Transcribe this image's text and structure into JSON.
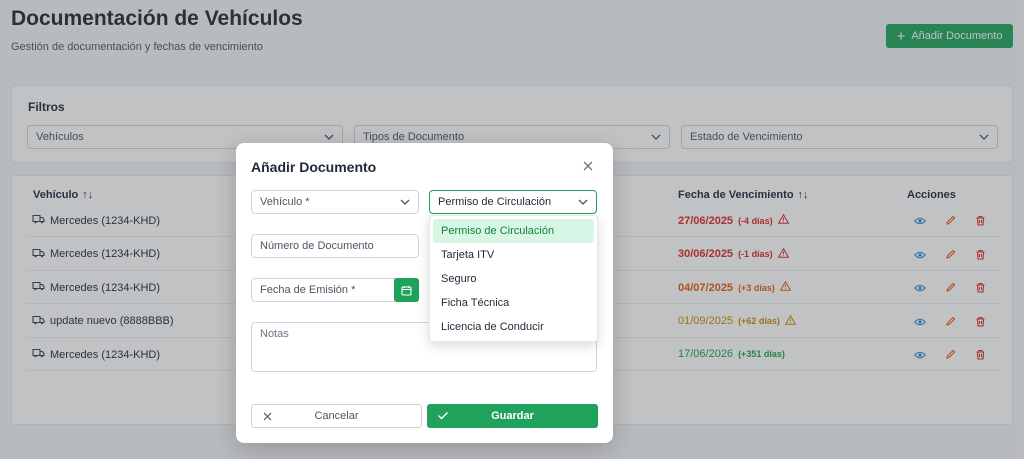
{
  "header": {
    "title": "Documentación de Vehículos",
    "subtitle": "Gestión de documentación y fechas de vencimiento",
    "add_button": "Añadir Documento"
  },
  "filters": {
    "title": "Filtros",
    "vehicles": "Vehículos",
    "doc_types": "Tipos de Documento",
    "expiry_state": "Estado de Vencimiento"
  },
  "table": {
    "col_vehicle": "Vehículo",
    "col_expiry": "Fecha de Vencimiento",
    "col_actions": "Acciones",
    "rows": [
      {
        "vehicle": "Mercedes (1234-KHD)",
        "date": "27/06/2025",
        "rel": "(-4 días)",
        "status": "red",
        "warn": true
      },
      {
        "vehicle": "Mercedes (1234-KHD)",
        "date": "30/06/2025",
        "rel": "(-1 días)",
        "status": "red",
        "warn": true
      },
      {
        "vehicle": "Mercedes (1234-KHD)",
        "date": "04/07/2025",
        "rel": "(+3 días)",
        "status": "orange",
        "warn": true
      },
      {
        "vehicle": "update nuevo (8888BBB)",
        "date": "01/09/2025",
        "rel": "(+62 días)",
        "status": "amber",
        "warn": true
      },
      {
        "vehicle": "Mercedes (1234-KHD)",
        "date": "17/06/2026",
        "rel": "(+351 días)",
        "status": "green",
        "warn": false
      }
    ]
  },
  "modal": {
    "title": "Añadir Documento",
    "vehicle_placeholder": "Vehículo *",
    "doc_type_value": "Permiso de Circulación",
    "doc_number_placeholder": "Número de Documento",
    "issue_date_placeholder": "Fecha de Emisión *",
    "notes_placeholder": "Notas",
    "cancel": "Cancelar",
    "save": "Guardar",
    "options": [
      "Permiso de Circulación",
      "Tarjeta ITV",
      "Seguro",
      "Ficha Técnica",
      "Licencia de Conducir"
    ]
  },
  "colors": {
    "accent": "#1fa35c",
    "danger": "#dc2626",
    "warning": "#ea580c",
    "caution": "#ca8a04",
    "ok": "#16a34a"
  }
}
